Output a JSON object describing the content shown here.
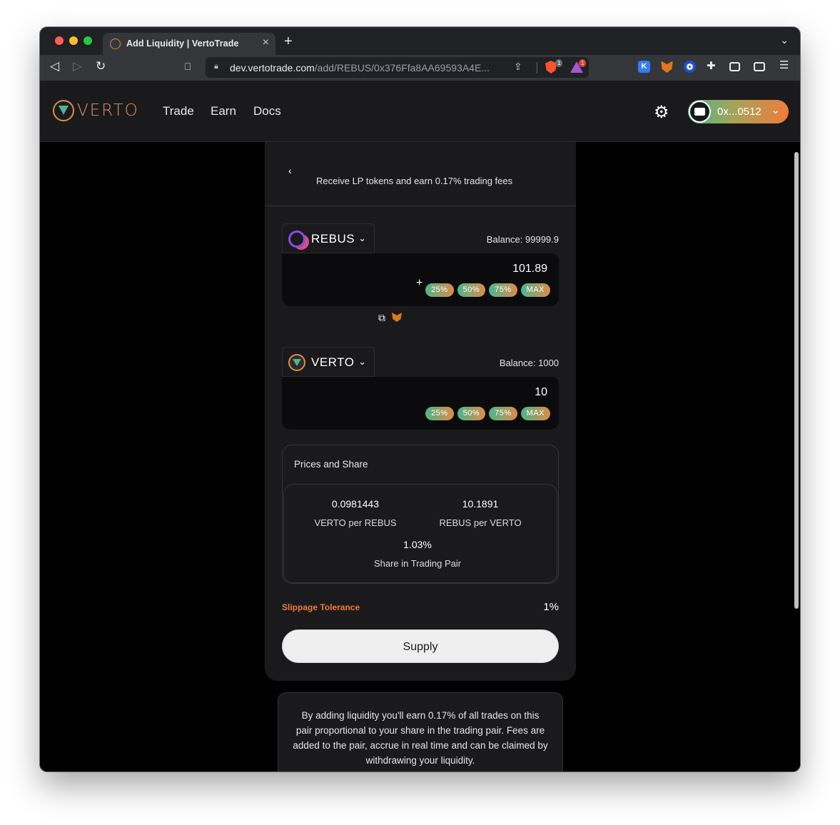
{
  "browser": {
    "tab_title": "Add Liquidity | VertoTrade",
    "url_host": "dev.vertotrade.com",
    "url_path": "/add/REBUS/0x376Ffa8AA69593A4E...",
    "badges": [
      "1",
      "1"
    ],
    "extension_k": "K"
  },
  "header": {
    "logo_text": "VERTO",
    "nav": [
      "Trade",
      "Earn",
      "Docs"
    ],
    "wallet_address": "0x...0512"
  },
  "card": {
    "subtitle": "Receive LP tokens and earn 0.17% trading fees",
    "token_a": {
      "symbol": "REBUS",
      "balance": "Balance: 99999.9",
      "amount": "101.89"
    },
    "plus": "+",
    "token_b": {
      "symbol": "VERTO",
      "balance": "Balance: 1000",
      "amount": "10"
    },
    "percent_buttons": [
      "25%",
      "50%",
      "75%",
      "MAX"
    ],
    "prices": {
      "title": "Prices and Share",
      "a_per_b_value": "0.0981443",
      "a_per_b_label": "VERTO per REBUS",
      "b_per_a_value": "10.1891",
      "b_per_a_label": "REBUS per VERTO",
      "share_value": "1.03%",
      "share_label": "Share in Trading Pair"
    },
    "slippage_label": "Slippage Tolerance",
    "slippage_value": "1%",
    "supply_label": "Supply"
  },
  "info_text": "By adding liquidity you'll earn 0.17% of all trades on this pair proportional to your share in the trading pair. Fees are added to the pair, accrue in real time and can be claimed by withdrawing your liquidity.",
  "colors": {
    "accent_orange": "#f07b3a",
    "accent_green": "#4bb58d",
    "background": "#000000",
    "card": "#1a1a1c"
  }
}
